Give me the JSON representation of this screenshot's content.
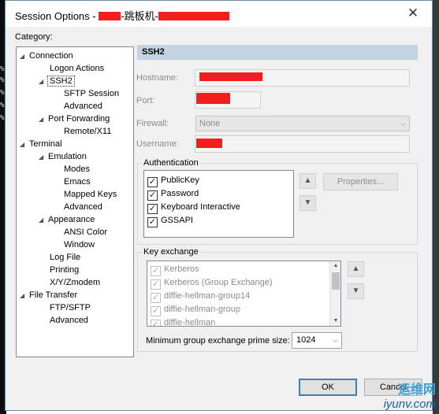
{
  "window": {
    "title_prefix": "Session Options - ",
    "title_middle": "-跳板机-",
    "close_glyph": "✕"
  },
  "category": {
    "label": "Category:",
    "items": [
      {
        "label": "Connection",
        "expanded": true
      },
      {
        "label": "Logon Actions"
      },
      {
        "label": "SSH2",
        "expanded": true,
        "selected": true
      },
      {
        "label": "SFTP Session"
      },
      {
        "label": "Advanced"
      },
      {
        "label": "Port Forwarding",
        "expanded": true
      },
      {
        "label": "Remote/X11"
      },
      {
        "label": "Terminal",
        "expanded": true
      },
      {
        "label": "Emulation",
        "expanded": true
      },
      {
        "label": "Modes"
      },
      {
        "label": "Emacs"
      },
      {
        "label": "Mapped Keys"
      },
      {
        "label": "Advanced"
      },
      {
        "label": "Appearance",
        "expanded": true
      },
      {
        "label": "ANSI Color"
      },
      {
        "label": "Window"
      },
      {
        "label": "Log File"
      },
      {
        "label": "Printing"
      },
      {
        "label": "X/Y/Zmodem"
      },
      {
        "label": "File Transfer",
        "expanded": true
      },
      {
        "label": "FTP/SFTP"
      },
      {
        "label": "Advanced"
      }
    ]
  },
  "panel": {
    "header": "SSH2",
    "hostname_label": "Hostname:",
    "port_label": "Port:",
    "firewall_label": "Firewall:",
    "firewall_value": "None",
    "username_label": "Username:"
  },
  "authentication": {
    "legend": "Authentication",
    "items": [
      {
        "label": "PublicKey",
        "checked": true
      },
      {
        "label": "Password",
        "checked": true
      },
      {
        "label": "Keyboard Interactive",
        "checked": true
      },
      {
        "label": "GSSAPI",
        "checked": true
      }
    ],
    "properties_button": "Properties..."
  },
  "key_exchange": {
    "legend": "Key exchange",
    "items": [
      {
        "label": "Kerberos",
        "checked": true
      },
      {
        "label": "Kerberos (Group Exchange)",
        "checked": true
      },
      {
        "label": "diffie-hellman-group14",
        "checked": true
      },
      {
        "label": "diffie-hellman-group",
        "checked": true
      },
      {
        "label": "diffie-hellman",
        "checked": true
      }
    ],
    "min_prime_label": "Minimum group exchange prime size:",
    "min_prime_value": "1024"
  },
  "buttons": {
    "ok": "OK",
    "cancel": "Cancel"
  },
  "watermark": {
    "logo_text": "运维网",
    "url": "iyunv.com"
  },
  "colors": {
    "redaction": "#f31f1f",
    "header_bg": "#c3d3e3"
  }
}
